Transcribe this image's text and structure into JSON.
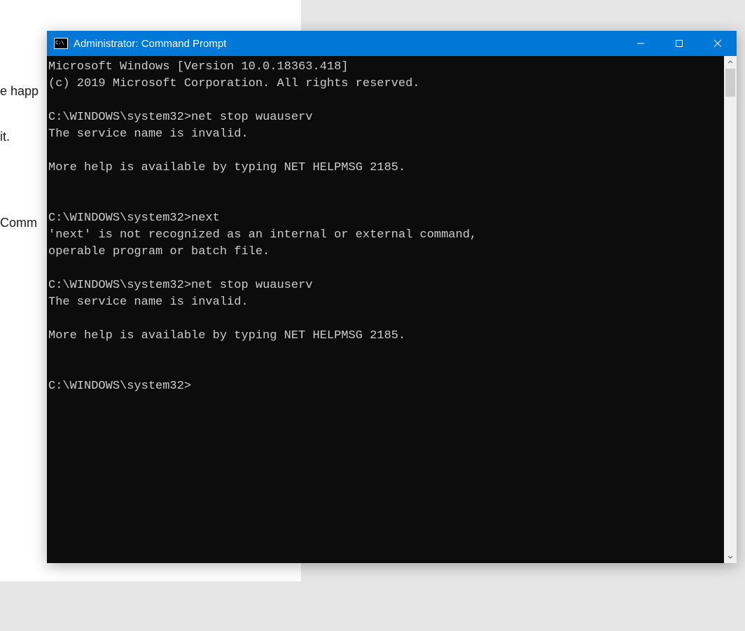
{
  "background": {
    "text1": "e happ",
    "text2": "it.",
    "text3": "Comm"
  },
  "window": {
    "title": "Administrator: Command Prompt"
  },
  "terminal": {
    "banner1": "Microsoft Windows [Version 10.0.18363.418]",
    "banner2": "(c) 2019 Microsoft Corporation. All rights reserved.",
    "blocks": [
      {
        "prompt": "C:\\WINDOWS\\system32>",
        "command": "net stop wuauserv",
        "output": "The service name is invalid.\n\nMore help is available by typing NET HELPMSG 2185."
      },
      {
        "prompt": "C:\\WINDOWS\\system32>",
        "command": "next",
        "output": "'next' is not recognized as an internal or external command,\noperable program or batch file."
      },
      {
        "prompt": "C:\\WINDOWS\\system32>",
        "command": "net stop wuauserv",
        "output": "The service name is invalid.\n\nMore help is available by typing NET HELPMSG 2185."
      }
    ],
    "final_prompt": "C:\\WINDOWS\\system32>"
  }
}
